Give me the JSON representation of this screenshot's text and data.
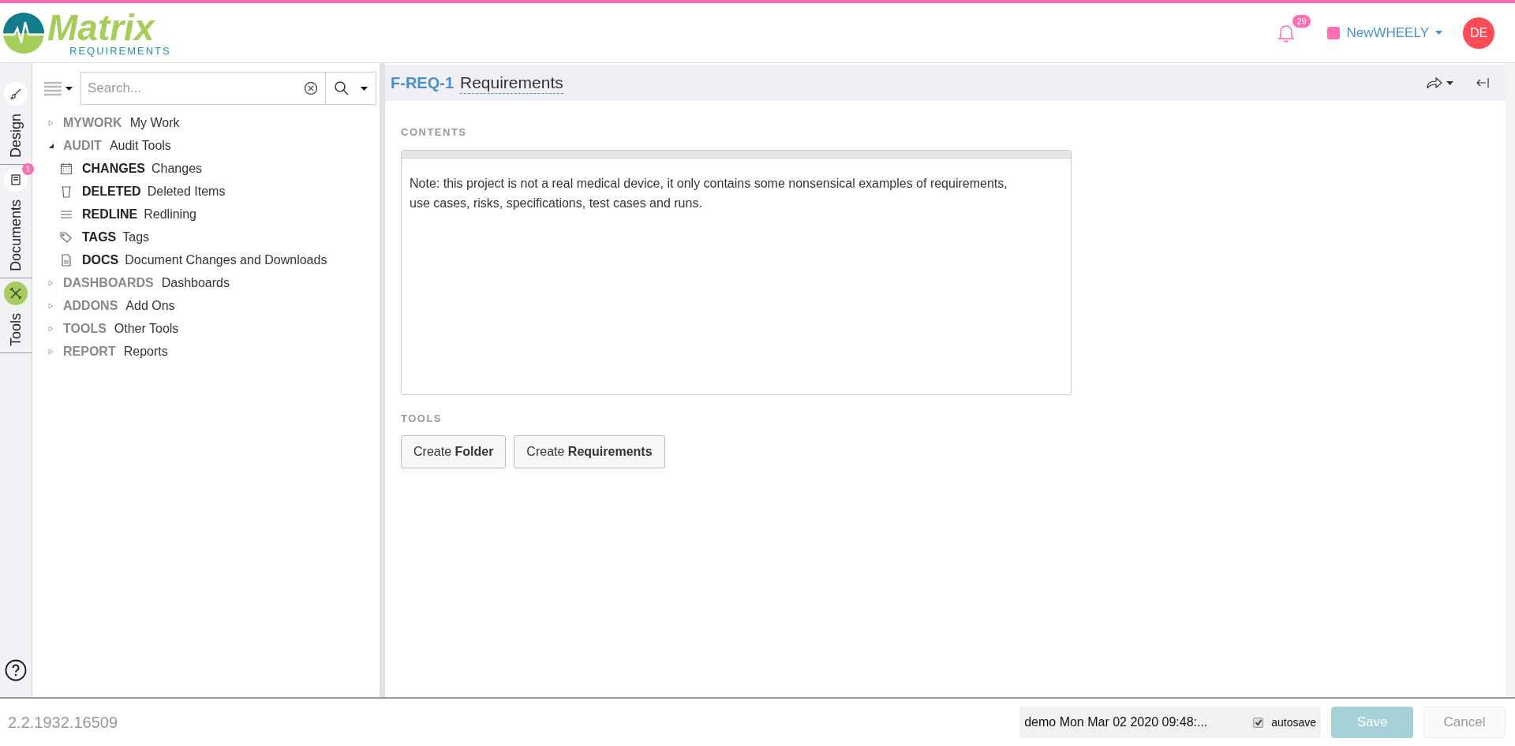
{
  "header": {
    "logo": {
      "title": "Matrix",
      "subtitle": "REQUIREMENTS"
    },
    "notifications": {
      "count": "29"
    },
    "project": {
      "name": "NewWHEELY",
      "color": "#ff6eb4"
    },
    "avatar": "DE"
  },
  "rail": [
    {
      "label": "Design",
      "kind": "brush",
      "selected": false
    },
    {
      "label": "Documents",
      "kind": "book",
      "selected": false,
      "badge": "1"
    },
    {
      "label": "Tools",
      "kind": "tools",
      "selected": true
    }
  ],
  "search": {
    "placeholder": "Search..."
  },
  "tree": [
    {
      "code": "MYWORK",
      "label": "My Work",
      "expanded": false
    },
    {
      "code": "AUDIT",
      "label": "Audit Tools",
      "expanded": true,
      "children": [
        {
          "code": "CHANGES",
          "label": "Changes",
          "kind": "calendar"
        },
        {
          "code": "DELETED",
          "label": "Deleted Items",
          "kind": "trash"
        },
        {
          "code": "REDLINE",
          "label": "Redlining",
          "kind": "lines"
        },
        {
          "code": "TAGS",
          "label": "Tags",
          "kind": "tag"
        },
        {
          "code": "DOCS",
          "label": "Document Changes and Downloads",
          "kind": "document"
        }
      ]
    },
    {
      "code": "DASHBOARDS",
      "label": "Dashboards",
      "expanded": false
    },
    {
      "code": "ADDONS",
      "label": "Add Ons",
      "expanded": false
    },
    {
      "code": "TOOLS",
      "label": "Other Tools",
      "expanded": false
    },
    {
      "code": "REPORT",
      "label": "Reports",
      "expanded": false
    }
  ],
  "item": {
    "id": "F-REQ-1",
    "title": "Requirements"
  },
  "contents": {
    "heading": "CONTENTS",
    "text": "Note: this project is not a real medical device, it only contains some nonsensical examples of requirements, use cases, risks, specifications, test cases and runs."
  },
  "tools": {
    "heading": "TOOLS",
    "buttons": [
      "Create **Folder**",
      "Create **Requirements**"
    ]
  },
  "footer": {
    "version": "2.2.1932.16509",
    "status": "demo Mon Mar 02 2020 09:48:...",
    "autosave": {
      "label": "autosave",
      "checked": true
    },
    "save": {
      "label": "Save",
      "disabled": false
    },
    "cancel": {
      "label": "Cancel",
      "disabled": true
    }
  }
}
